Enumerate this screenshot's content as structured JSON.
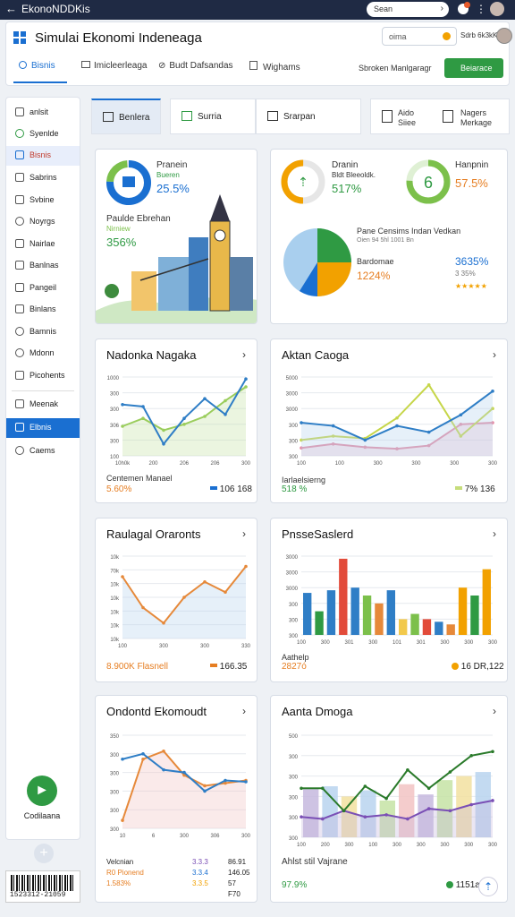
{
  "topbar": {
    "back_glyph": "←",
    "title": "EkonoNDDKis",
    "search_label": "Sean",
    "search_chevron": "›"
  },
  "header": {
    "title": "Simulai Ekonomi Indeneaga",
    "search_placeholder": "oima",
    "user_name": "Sdrb 6k3kK",
    "tabs": [
      {
        "label": "Bisnis"
      },
      {
        "label": "Imicleerleaga"
      },
      {
        "label": "Budt Dafsandas"
      },
      {
        "label": "Wighams"
      }
    ],
    "manager_label": "Sbroken Manlgaragr",
    "button_label": "Beiarace"
  },
  "sidebar": {
    "items": [
      {
        "label": "anlsit"
      },
      {
        "label": "Syenlde"
      },
      {
        "label": "Bisnis"
      },
      {
        "label": "Sabrins"
      },
      {
        "label": "Svbine"
      },
      {
        "label": "Noyrgs"
      },
      {
        "label": "Nairlae"
      },
      {
        "label": "Banlnas"
      },
      {
        "label": "Pangeil"
      },
      {
        "label": "Binlans"
      },
      {
        "label": "Bamnis"
      },
      {
        "label": "Mdonn"
      },
      {
        "label": "Picohents"
      },
      {
        "label": "Meenak"
      },
      {
        "label": "Elbnis"
      },
      {
        "label": "Caems"
      }
    ],
    "fab_label": "Codilaana",
    "fab_glyph": "►",
    "plus_glyph": "+",
    "barcode_number": "1523312-21059"
  },
  "tabs": [
    {
      "label": "Benlera"
    },
    {
      "label": "Surria"
    },
    {
      "label": "Srarpan"
    }
  ],
  "tabs_right": {
    "a": "Aido\nSiiee",
    "b": "Nagers\nMerkage"
  },
  "hero": {
    "title": "Pranein",
    "subtitle": "Bueren",
    "value": "25.5%",
    "sub_title": "Paulde Ebrehan",
    "sub_note": "Nirniew",
    "sub_value": "356%"
  },
  "stats": {
    "left": {
      "title": "Dranin",
      "subtitle": "Bldt Bleeoldk.",
      "value": "517%"
    },
    "right": {
      "title": "Hanpnin",
      "value": "57.5%"
    },
    "pie_title": "Pane Censims Indan Vedkan",
    "pie_sub": "Oien 94 5hl 1001 Bn",
    "pie_label": "Bardomae",
    "pie_value": "1224%",
    "pie_value2": "3635%",
    "pie_stars": "3 35%",
    "pie_value2_color": "#1a6fd1"
  },
  "charts": [
    {
      "title": "Nadonka Nagaka",
      "arrow": "›",
      "y_ticks": [
        "1000",
        "300",
        "300",
        "306",
        "300",
        "100"
      ],
      "x_ticks": [
        "10h0k",
        "200",
        "206",
        "206",
        "300"
      ],
      "legend_left": "Centemen Manael",
      "left_value": "5.60%",
      "right_value": "106 168"
    },
    {
      "title": "Aktan Caoga",
      "arrow": "›",
      "y_ticks": [
        "5000",
        "3000",
        "3000",
        "300",
        "300",
        "300"
      ],
      "x_ticks": [
        "100",
        "100",
        "300",
        "300",
        "300",
        "300"
      ],
      "legend_left": "Iarlaelsierng",
      "left_value": "518 %",
      "right_value": "7% 136"
    },
    {
      "title": "Raulagal Oraronts",
      "arrow": "›",
      "y_ticks": [
        "10k",
        "70k",
        "10k",
        "10k",
        "10k",
        "10k",
        "10k"
      ],
      "x_ticks": [
        "100",
        "300",
        "300",
        "330"
      ],
      "legend_left": "",
      "left_value": "8.900K Flasnell",
      "right_value": "166.35"
    },
    {
      "title": "PnsseSaslerd",
      "arrow": "›",
      "y_ticks": [
        "3000",
        "3000",
        "3000",
        "300",
        "300",
        "300"
      ],
      "x_ticks": [
        "100",
        "300",
        "301",
        "300",
        "101",
        "301",
        "300",
        "300",
        "300"
      ],
      "legend_left": "Aathelp",
      "left_value": "2827ó",
      "right_value": "16 DR,122"
    },
    {
      "title": "Ondontd Ekomoudt",
      "arrow": "›",
      "y_ticks": [
        "350",
        "300",
        "300",
        "300",
        "300",
        "300"
      ],
      "x_ticks": [
        "10",
        "6",
        "300",
        "306",
        "300"
      ],
      "legend_left": "",
      "left_value": "",
      "right_value": ""
    },
    {
      "title": "Aanta Dmoga",
      "arrow": "›",
      "y_ticks": [
        "500",
        "300",
        "300",
        "300",
        "300",
        "300"
      ],
      "x_ticks": [
        "100",
        "200",
        "300",
        "100",
        "300",
        "300",
        "300",
        "300",
        "300"
      ],
      "legend_left": "",
      "left_value": "",
      "right_value": ""
    }
  ],
  "legend5": {
    "head": "Velcnian",
    "r1a": "R0 Pionend",
    "r1b": "3.3.3",
    "r1c": "86.91",
    "r2b": "3.3.4",
    "r2c": "146.05",
    "r3a": "1.583%",
    "r3b": "3.3.5",
    "r3c": "57 F70"
  },
  "legend6": {
    "title": "Ahlst stil Vajrane",
    "value": "97.9%",
    "right": "1151a"
  },
  "chart_data": [
    {
      "type": "line",
      "title": "Nadonka Nagaka",
      "x": [
        "10h0k",
        "200",
        "206",
        "206",
        "300"
      ],
      "series": [
        {
          "values": [
            520,
            500,
            120,
            380,
            580,
            420,
            780
          ]
        },
        {
          "values": [
            300,
            380,
            260,
            320,
            400,
            560,
            700
          ]
        }
      ]
    },
    {
      "type": "line",
      "title": "Aktan Caoga",
      "x": [
        "100",
        "100",
        "300",
        "300",
        "300",
        "300"
      ],
      "series": [
        {
          "values": [
            420,
            380,
            200,
            380,
            300,
            520,
            820
          ]
        },
        {
          "values": [
            200,
            250,
            220,
            480,
            900,
            250,
            600
          ]
        },
        {
          "values": [
            100,
            150,
            110,
            90,
            130,
            400,
            420
          ]
        }
      ]
    },
    {
      "type": "line",
      "title": "Raulagal Oraronts",
      "x": [
        "100",
        "300",
        "300",
        "330"
      ],
      "series": [
        {
          "values": [
            60,
            30,
            15,
            40,
            55,
            45,
            70
          ]
        }
      ]
    },
    {
      "type": "bar",
      "title": "PnsseSaslerd",
      "x": [
        "100",
        "300",
        "301",
        "300",
        "101",
        "301",
        "300",
        "300",
        "300"
      ],
      "series": [
        {
          "values": [
            1600,
            900,
            1700,
            2900,
            1800,
            1500,
            1200,
            1700,
            600,
            800,
            600,
            500,
            400,
            1800,
            1500,
            2500
          ]
        }
      ]
    },
    {
      "type": "line",
      "title": "Ondontd Ekomoudt",
      "x": [
        "10",
        "6",
        "300",
        "306",
        "300"
      ],
      "series": [
        {
          "values": [
            30,
            260,
            290,
            200,
            160,
            170,
            180
          ]
        },
        {
          "values": [
            260,
            280,
            220,
            210,
            140,
            180,
            175
          ]
        }
      ]
    },
    {
      "type": "line",
      "title": "Aanta Dmoga",
      "x": [
        "100",
        "200",
        "300",
        "100",
        "300",
        "300",
        "300",
        "300",
        "300"
      ],
      "series": [
        {
          "values": [
            240,
            240,
            130,
            250,
            190,
            330,
            240,
            320,
            400,
            420
          ]
        },
        {
          "values": [
            100,
            90,
            130,
            100,
            110,
            90,
            140,
            130,
            160,
            180
          ]
        }
      ]
    }
  ]
}
